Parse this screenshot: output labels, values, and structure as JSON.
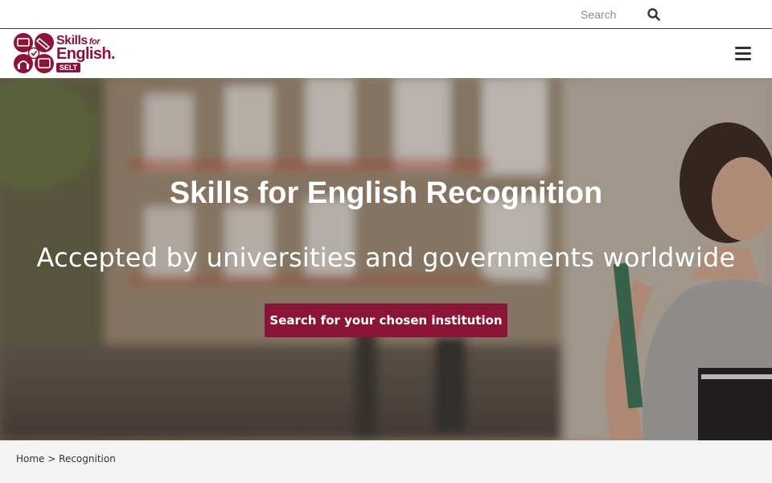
{
  "search": {
    "placeholder": "Search",
    "icon": "search-icon"
  },
  "logo": {
    "line1": "Skills",
    "line1_small": "for",
    "line2": "English.",
    "badge": "SELT",
    "brand_color": "#8a1538"
  },
  "header": {
    "menu_icon": "hamburger-menu-icon"
  },
  "hero": {
    "title": "Skills for English Recognition",
    "subtitle": "Accepted by universities and governments worldwide",
    "cta_label": "Search for your chosen institution",
    "cta_color": "#8a1538"
  },
  "breadcrumb": {
    "home": "Home",
    "separator": ">",
    "current": "Recognition"
  }
}
